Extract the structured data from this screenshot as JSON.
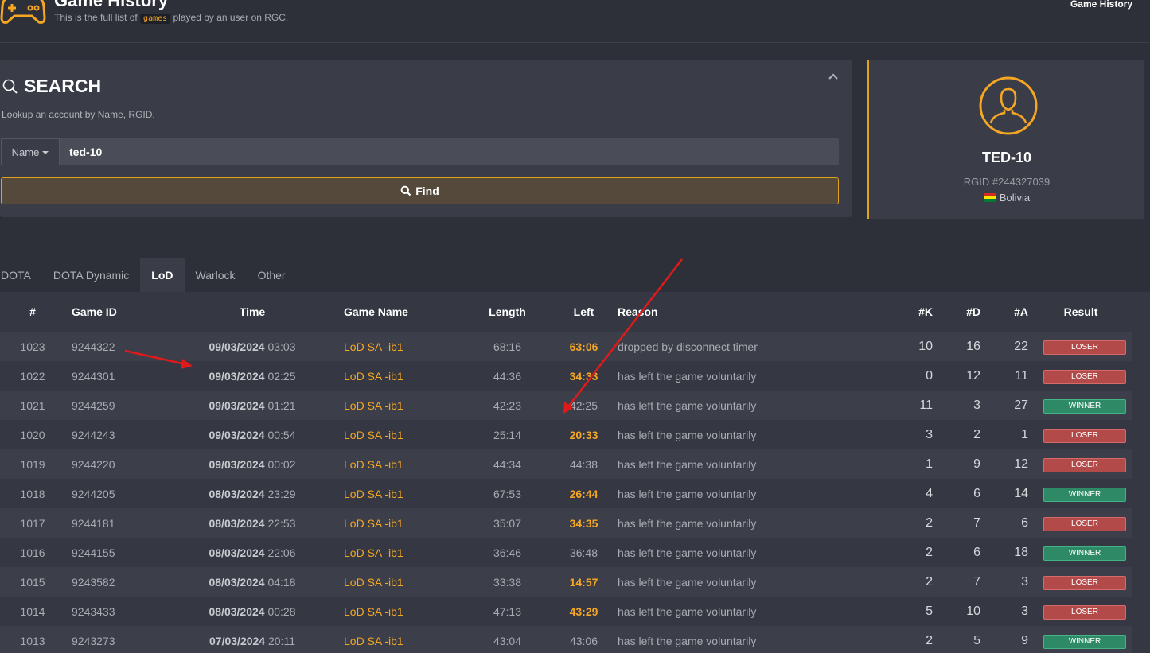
{
  "header": {
    "title": "Game History",
    "subtitle_before": "This is the full list of",
    "subtitle_code": "games",
    "subtitle_after": "played by an user on RGC.",
    "breadcrumb": "Game History"
  },
  "search": {
    "title": "SEARCH",
    "description": "Lookup an account by Name, RGID.",
    "field_select": "Name",
    "input_value": "ted-10",
    "find_label": "Find"
  },
  "profile": {
    "name": "TED-10",
    "rgid": "RGID #244327039",
    "country": "Bolivia",
    "accent_color": "#e0a31e"
  },
  "tabs": [
    "DOTA",
    "DOTA Dynamic",
    "LoD",
    "Warlock",
    "Other"
  ],
  "active_tab": "LoD",
  "table": {
    "headers": [
      "#",
      "Game ID",
      "Time",
      "Game Name",
      "Length",
      "Left",
      "Reason",
      "#K",
      "#D",
      "#A",
      "Result"
    ],
    "rows": [
      {
        "num": "1023",
        "game_id": "9244322",
        "date": "09/03/2024",
        "clock": "03:03",
        "game_name": "LoD SA -ib1",
        "length": "68:16",
        "left": "63:06",
        "left_hl": true,
        "reason": "dropped by disconnect timer",
        "k": "10",
        "d": "16",
        "a": "22",
        "result": "LOSER"
      },
      {
        "num": "1022",
        "game_id": "9244301",
        "date": "09/03/2024",
        "clock": "02:25",
        "game_name": "LoD SA -ib1",
        "length": "44:36",
        "left": "34:33",
        "left_hl": true,
        "reason": "has left the game voluntarily",
        "k": "0",
        "d": "12",
        "a": "11",
        "result": "LOSER"
      },
      {
        "num": "1021",
        "game_id": "9244259",
        "date": "09/03/2024",
        "clock": "01:21",
        "game_name": "LoD SA -ib1",
        "length": "42:23",
        "left": "42:25",
        "left_hl": false,
        "reason": "has left the game voluntarily",
        "k": "11",
        "d": "3",
        "a": "27",
        "result": "WINNER"
      },
      {
        "num": "1020",
        "game_id": "9244243",
        "date": "09/03/2024",
        "clock": "00:54",
        "game_name": "LoD SA -ib1",
        "length": "25:14",
        "left": "20:33",
        "left_hl": true,
        "reason": "has left the game voluntarily",
        "k": "3",
        "d": "2",
        "a": "1",
        "result": "LOSER"
      },
      {
        "num": "1019",
        "game_id": "9244220",
        "date": "09/03/2024",
        "clock": "00:02",
        "game_name": "LoD SA -ib1",
        "length": "44:34",
        "left": "44:38",
        "left_hl": false,
        "reason": "has left the game voluntarily",
        "k": "1",
        "d": "9",
        "a": "12",
        "result": "LOSER"
      },
      {
        "num": "1018",
        "game_id": "9244205",
        "date": "08/03/2024",
        "clock": "23:29",
        "game_name": "LoD SA -ib1",
        "length": "67:53",
        "left": "26:44",
        "left_hl": true,
        "reason": "has left the game voluntarily",
        "k": "4",
        "d": "6",
        "a": "14",
        "result": "WINNER"
      },
      {
        "num": "1017",
        "game_id": "9244181",
        "date": "08/03/2024",
        "clock": "22:53",
        "game_name": "LoD SA -ib1",
        "length": "35:07",
        "left": "34:35",
        "left_hl": true,
        "reason": "has left the game voluntarily",
        "k": "2",
        "d": "7",
        "a": "6",
        "result": "LOSER"
      },
      {
        "num": "1016",
        "game_id": "9244155",
        "date": "08/03/2024",
        "clock": "22:06",
        "game_name": "LoD SA -ib1",
        "length": "36:46",
        "left": "36:48",
        "left_hl": false,
        "reason": "has left the game voluntarily",
        "k": "2",
        "d": "6",
        "a": "18",
        "result": "WINNER"
      },
      {
        "num": "1015",
        "game_id": "9243582",
        "date": "08/03/2024",
        "clock": "04:18",
        "game_name": "LoD SA -ib1",
        "length": "33:38",
        "left": "14:57",
        "left_hl": true,
        "reason": "has left the game voluntarily",
        "k": "2",
        "d": "7",
        "a": "3",
        "result": "LOSER"
      },
      {
        "num": "1014",
        "game_id": "9243433",
        "date": "08/03/2024",
        "clock": "00:28",
        "game_name": "LoD SA -ib1",
        "length": "47:13",
        "left": "43:29",
        "left_hl": true,
        "reason": "has left the game voluntarily",
        "k": "5",
        "d": "10",
        "a": "3",
        "result": "LOSER"
      },
      {
        "num": "1013",
        "game_id": "9243273",
        "date": "07/03/2024",
        "clock": "20:11",
        "game_name": "LoD SA -ib1",
        "length": "43:04",
        "left": "43:06",
        "left_hl": false,
        "reason": "has left the game voluntarily",
        "k": "2",
        "d": "5",
        "a": "9",
        "result": "WINNER"
      }
    ]
  },
  "colors": {
    "background": "#2d3039",
    "panel": "#3a3d47",
    "accent": "#e0a31e",
    "highlight_text": "#f5a623",
    "loser": "#b34a4a",
    "winner": "#2e8a66",
    "annotation_arrow": "#e01a1a"
  }
}
